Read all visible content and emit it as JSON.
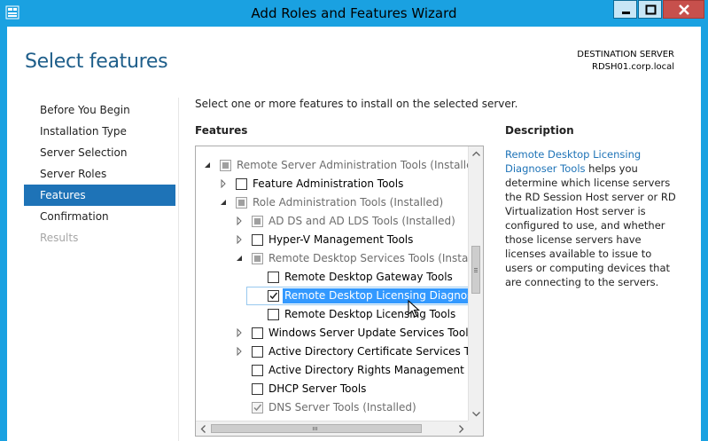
{
  "window": {
    "title": "Add Roles and Features Wizard"
  },
  "header": {
    "page_title": "Select features",
    "destination_label": "DESTINATION SERVER",
    "destination_server": "RDSH01.corp.local"
  },
  "nav": {
    "items": [
      {
        "label": "Before You Begin",
        "state": "normal"
      },
      {
        "label": "Installation Type",
        "state": "normal"
      },
      {
        "label": "Server Selection",
        "state": "normal"
      },
      {
        "label": "Server Roles",
        "state": "normal"
      },
      {
        "label": "Features",
        "state": "active"
      },
      {
        "label": "Confirmation",
        "state": "normal"
      },
      {
        "label": "Results",
        "state": "disabled"
      }
    ]
  },
  "main": {
    "instruction": "Select one or more features to install on the selected server.",
    "features_heading": "Features",
    "description_heading": "Description",
    "description_link": "Remote Desktop Licensing Diagnoser Tools",
    "description_text": " helps you determine which license servers the RD Session Host server or RD Virtualization Host server is configured to use, and whether those license servers have licenses available to issue to users or computing devices that are connecting to the servers."
  },
  "tree": {
    "rows": [
      {
        "label": "Remote Server Administration Tools (Installed)",
        "level": 0,
        "expander": "expanded",
        "check": "partial-disabled",
        "label_state": "disabled"
      },
      {
        "label": "Feature Administration Tools",
        "level": 1,
        "expander": "collapsed",
        "check": "unchecked",
        "label_state": "normal"
      },
      {
        "label": "Role Administration Tools (Installed)",
        "level": 1,
        "expander": "expanded",
        "check": "partial-disabled",
        "label_state": "disabled"
      },
      {
        "label": "AD DS and AD LDS Tools (Installed)",
        "level": 2,
        "expander": "collapsed",
        "check": "partial-disabled",
        "label_state": "disabled"
      },
      {
        "label": "Hyper-V Management Tools",
        "level": 2,
        "expander": "collapsed",
        "check": "unchecked",
        "label_state": "normal"
      },
      {
        "label": "Remote Desktop Services Tools (Installed)",
        "level": 2,
        "expander": "expanded",
        "check": "partial-disabled",
        "label_state": "disabled"
      },
      {
        "label": "Remote Desktop Gateway Tools",
        "level": 3,
        "expander": "none",
        "check": "unchecked",
        "label_state": "normal"
      },
      {
        "label": "Remote Desktop Licensing Diagnoser Tools",
        "level": 3,
        "expander": "none",
        "check": "checked",
        "label_state": "selected"
      },
      {
        "label": "Remote Desktop Licensing Tools",
        "level": 3,
        "expander": "none",
        "check": "unchecked",
        "label_state": "normal"
      },
      {
        "label": "Windows Server Update Services Tools",
        "level": 2,
        "expander": "collapsed",
        "check": "unchecked",
        "label_state": "normal"
      },
      {
        "label": "Active Directory Certificate Services Tools",
        "level": 2,
        "expander": "collapsed",
        "check": "unchecked",
        "label_state": "normal"
      },
      {
        "label": "Active Directory Rights Management Services Tools",
        "level": 2,
        "expander": "none",
        "check": "unchecked",
        "label_state": "normal"
      },
      {
        "label": "DHCP Server Tools",
        "level": 2,
        "expander": "none",
        "check": "unchecked",
        "label_state": "normal"
      },
      {
        "label": "DNS Server Tools (Installed)",
        "level": 2,
        "expander": "none",
        "check": "checked-disabled",
        "label_state": "disabled"
      }
    ]
  },
  "icons": {
    "window_buttons": [
      "minimize-icon",
      "maximize-icon",
      "close-icon"
    ],
    "app_icon": "server-manager-icon"
  },
  "colors": {
    "titlebar": "#1aa1e1",
    "nav_active": "#1e73b7",
    "selection": "#3399ff",
    "link": "#1e73b7",
    "close_button": "#c7504c"
  }
}
